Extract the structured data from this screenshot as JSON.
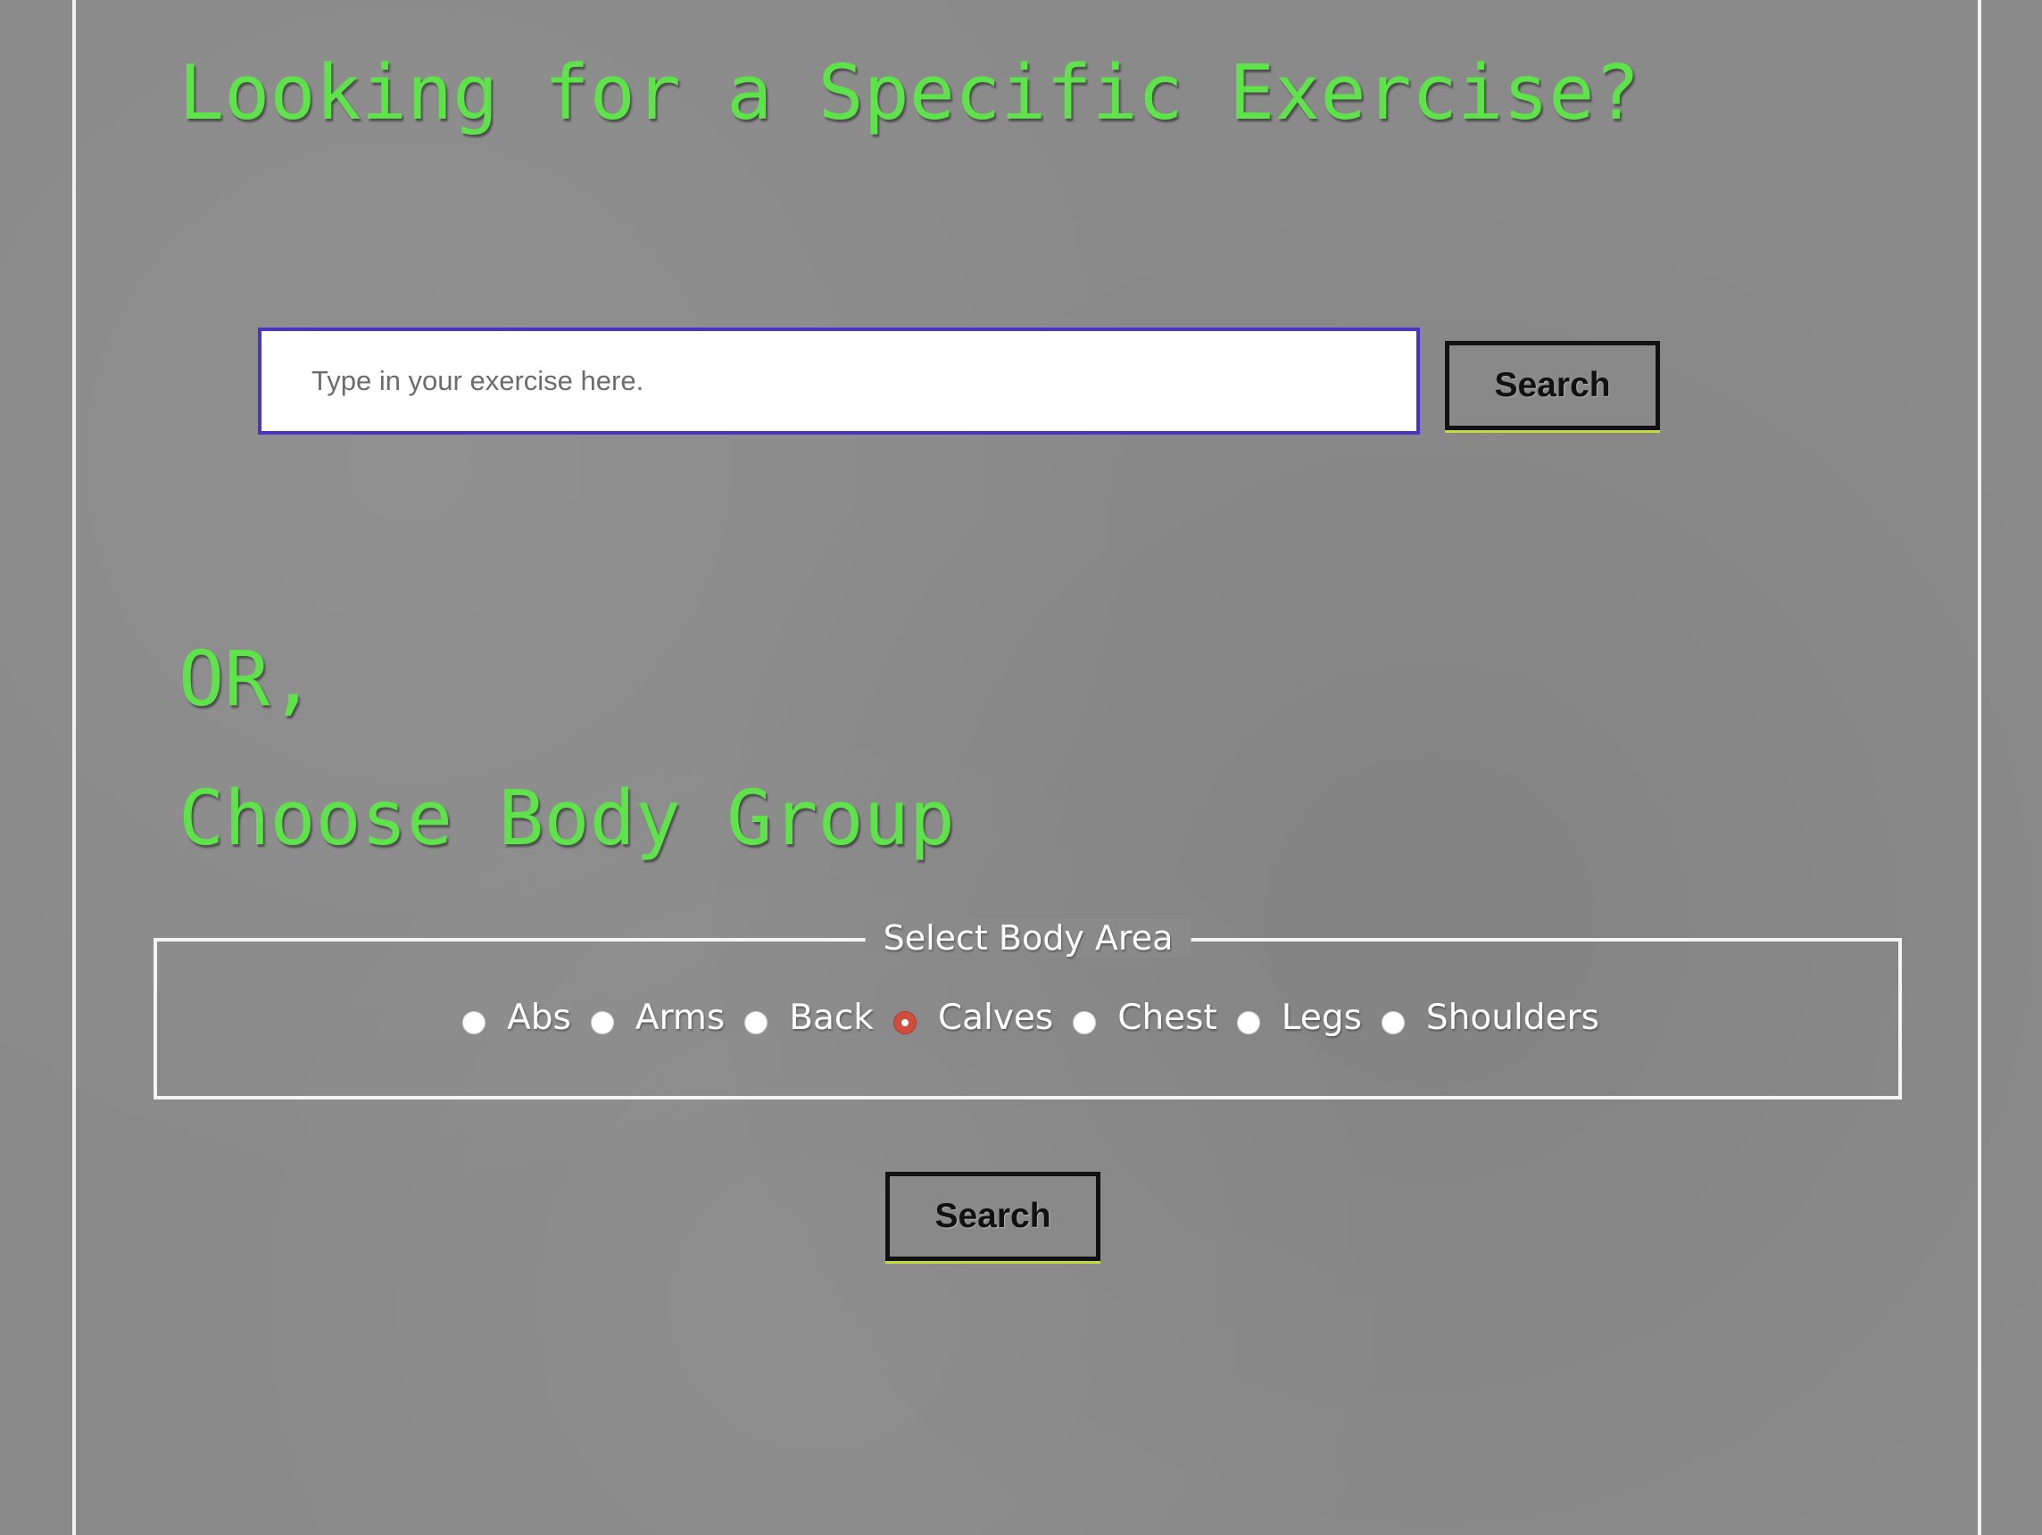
{
  "header": {
    "title": "Looking for a Specific Exercise?"
  },
  "search": {
    "placeholder": "Type in your exercise here.",
    "value": "",
    "button_label": "Search"
  },
  "divider_text": "OR,",
  "body_group": {
    "title": "Choose Body Group",
    "legend": "Select Body Area",
    "options": [
      {
        "label": "Abs",
        "selected": false
      },
      {
        "label": "Arms",
        "selected": false
      },
      {
        "label": "Back",
        "selected": false
      },
      {
        "label": "Calves",
        "selected": true
      },
      {
        "label": "Chest",
        "selected": false
      },
      {
        "label": "Legs",
        "selected": false
      },
      {
        "label": "Shoulders",
        "selected": false
      }
    ],
    "selected_value": "Calves",
    "button_label": "Search"
  },
  "colors": {
    "heading": "#5ee34a",
    "background": "#8a8a8a",
    "input_border": "#4a33c7",
    "radio_selected": "#cf4e3c",
    "button_border": "#111111",
    "button_underline": "#c7d83a"
  }
}
